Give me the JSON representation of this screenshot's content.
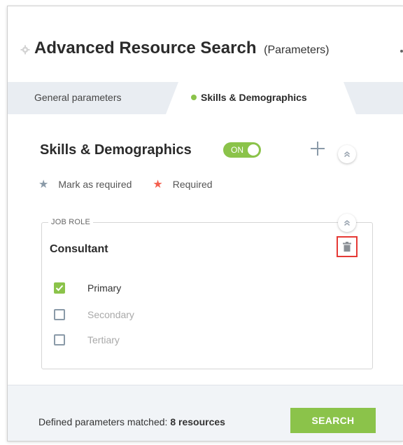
{
  "header": {
    "title": "Advanced Resource Search",
    "subtitle": "(Parameters)"
  },
  "tabs": [
    {
      "label": "General parameters",
      "active": false
    },
    {
      "label": "Skills & Demographics",
      "active": true
    }
  ],
  "section": {
    "title": "Skills & Demographics",
    "toggle_label": "ON",
    "toggle_on": true
  },
  "legend": {
    "mark_as_required": "Mark as required",
    "required": "Required"
  },
  "card": {
    "caption": "JOB ROLE",
    "title": "Consultant",
    "options": [
      {
        "label": "Primary",
        "checked": true
      },
      {
        "label": "Secondary",
        "checked": false
      },
      {
        "label": "Tertiary",
        "checked": false
      }
    ]
  },
  "footer": {
    "matched_prefix": "Defined parameters matched:",
    "matched_value": "8 resources",
    "search_label": "SEARCH"
  },
  "colors": {
    "accent": "#8bc34a",
    "required_star": "#f4604f",
    "highlight": "#e53935"
  },
  "icons": [
    "gear-icon",
    "plus-icon",
    "chevron-double-up-icon",
    "trash-icon",
    "star-icon",
    "check-icon"
  ]
}
